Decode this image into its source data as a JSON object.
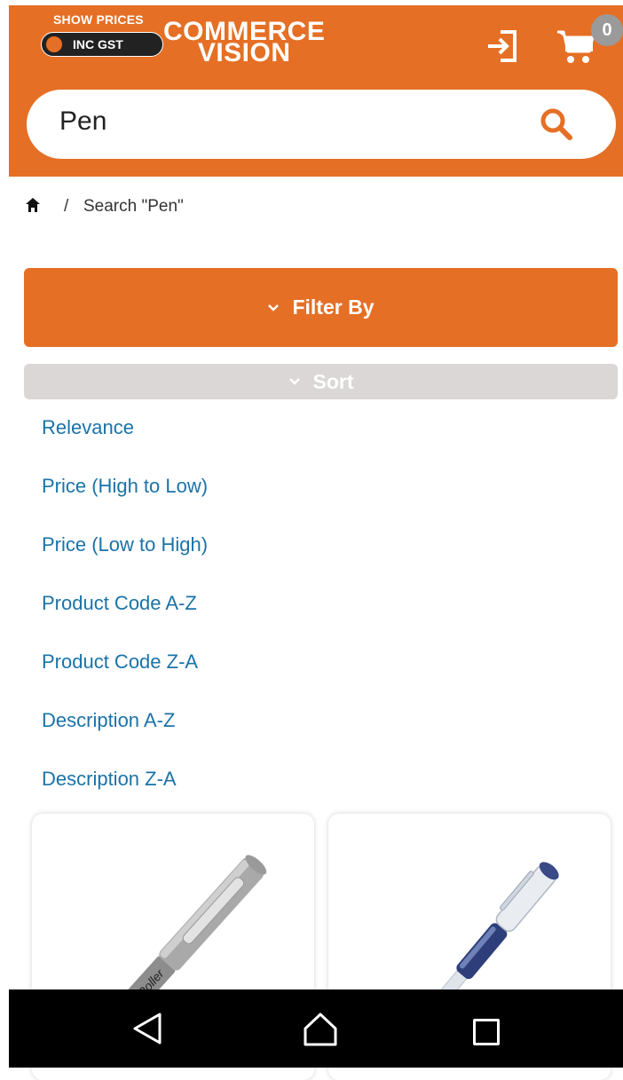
{
  "header": {
    "show_prices_label": "SHOW PRICES",
    "gst_toggle_label": "INC GST",
    "logo_line1": "COMMERCE",
    "logo_line2": "VISION",
    "cart_count": "0",
    "accent_color": "#E56F25"
  },
  "search": {
    "value": "Pen"
  },
  "breadcrumb": {
    "separator": "/",
    "current": "Search \"Pen\""
  },
  "filter": {
    "label": "Filter By"
  },
  "sort": {
    "label": "Sort",
    "options": [
      "Relevance",
      "Price (High to Low)",
      "Price (Low to High)",
      "Product Code A-Z",
      "Product Code Z-A",
      "Description A-Z",
      "Description Z-A"
    ]
  },
  "products": [
    {
      "image_label": "RipRoller"
    },
    {
      "image_label": ""
    }
  ],
  "icons": {
    "login": "login-icon",
    "cart": "cart-icon",
    "search": "search-icon",
    "home": "home-icon"
  }
}
